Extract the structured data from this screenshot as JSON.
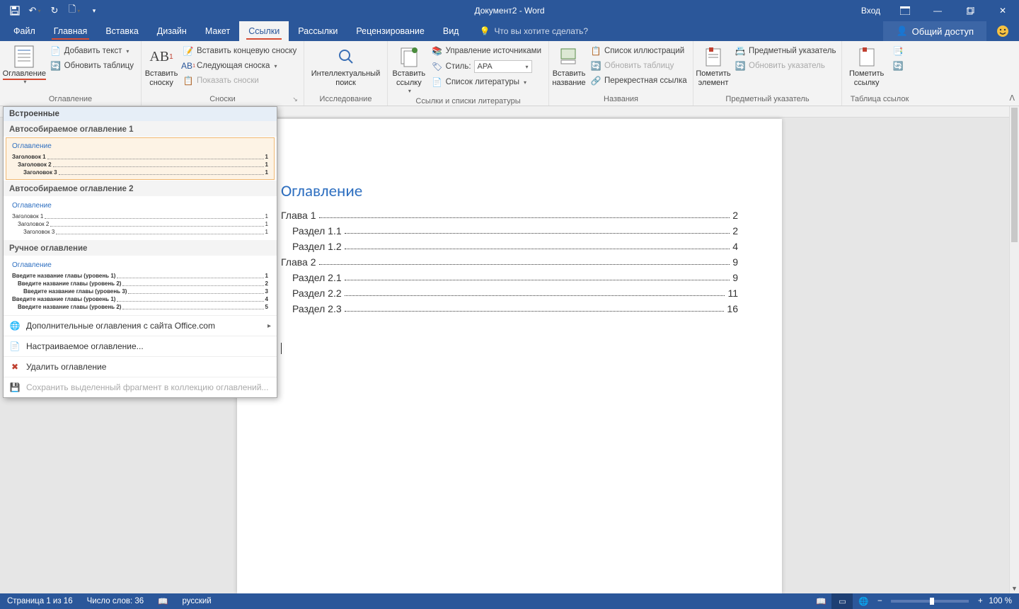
{
  "title": "Документ2  -  Word",
  "qat": {
    "save": "💾",
    "undo": "↶",
    "redo": "↻",
    "new": "🗋",
    "custom": "▾"
  },
  "titlebar_right": {
    "signin": "Вход",
    "ribbon_display": "▭",
    "minimize": "—",
    "maximize": "▢",
    "close": "✕"
  },
  "tabs": {
    "file": "Файл",
    "home": "Главная",
    "insert": "Вставка",
    "design": "Дизайн",
    "layout": "Макет",
    "references": "Ссылки",
    "mailings": "Рассылки",
    "review": "Рецензирование",
    "view": "Вид",
    "tellme_placeholder": "Что вы хотите сделать?",
    "share": "Общий доступ"
  },
  "ribbon": {
    "toc_btn": "Оглавление",
    "add_text": "Добавить текст",
    "update_table": "Обновить таблицу",
    "group_toc": "Оглавление",
    "insert_footnote": "Вставить\nсноску",
    "insert_endnote": "Вставить концевую сноску",
    "next_footnote": "Следующая сноска",
    "show_notes": "Показать сноски",
    "group_footnotes": "Сноски",
    "smart_lookup": "Интеллектуальный\nпоиск",
    "group_research": "Исследование",
    "insert_citation": "Вставить\nссылку",
    "manage_sources": "Управление источниками",
    "style_label": "Стиль:",
    "style_value": "APA",
    "bibliography": "Список литературы",
    "group_citations": "Ссылки и списки литературы",
    "insert_caption": "Вставить\nназвание",
    "figure_list": "Список иллюстраций",
    "update_table2": "Обновить таблицу",
    "cross_ref": "Перекрестная ссылка",
    "group_captions": "Названия",
    "mark_entry": "Пометить\nэлемент",
    "insert_index": "Предметный указатель",
    "update_index": "Обновить указатель",
    "group_index": "Предметный указатель",
    "mark_citation": "Пометить\nссылку",
    "insert_toa": "📑",
    "update_toa": "🔄",
    "group_toa": "Таблица ссылок"
  },
  "gallery": {
    "builtin_label": "Встроенные",
    "auto1_title": "Автособираемое оглавление 1",
    "auto2_title": "Автособираемое оглавление 2",
    "manual_title": "Ручное оглавление",
    "preview_title": "Оглавление",
    "auto1_lines": [
      {
        "t": "Заголовок 1",
        "p": "1",
        "indent": 0
      },
      {
        "t": "Заголовок 2",
        "p": "1",
        "indent": 1
      },
      {
        "t": "Заголовок 3",
        "p": "1",
        "indent": 2
      }
    ],
    "auto2_lines": [
      {
        "t": "Заголовок 1",
        "p": "1",
        "indent": 0
      },
      {
        "t": "Заголовок 2",
        "p": "1",
        "indent": 1
      },
      {
        "t": "Заголовок 3",
        "p": "1",
        "indent": 2
      }
    ],
    "manual_lines": [
      {
        "t": "Введите название главы (уровень 1)",
        "p": "1",
        "indent": 0
      },
      {
        "t": "Введите название главы (уровень 2)",
        "p": "2",
        "indent": 1
      },
      {
        "t": "Введите название главы (уровень 3)",
        "p": "3",
        "indent": 2
      },
      {
        "t": "Введите название главы (уровень 1)",
        "p": "4",
        "indent": 0
      },
      {
        "t": "Введите название главы (уровень 2)",
        "p": "5",
        "indent": 1
      }
    ],
    "cmd_more": "Дополнительные оглавления с сайта Office.com",
    "cmd_custom": "Настраиваемое оглавление...",
    "cmd_remove": "Удалить оглавление",
    "cmd_save": "Сохранить выделенный фрагмент в коллекцию оглавлений..."
  },
  "document": {
    "toc_title": "Оглавление",
    "rows": [
      {
        "level": 1,
        "text": "Глава 1",
        "page": "2"
      },
      {
        "level": 2,
        "text": "Раздел 1.1",
        "page": "2"
      },
      {
        "level": 2,
        "text": "Раздел 1.2",
        "page": "4"
      },
      {
        "level": 1,
        "text": "Глава 2",
        "page": "9"
      },
      {
        "level": 2,
        "text": "Раздел 2.1",
        "page": "9"
      },
      {
        "level": 2,
        "text": "Раздел 2.2",
        "page": "11"
      },
      {
        "level": 2,
        "text": "Раздел 2.3",
        "page": "16"
      }
    ]
  },
  "status": {
    "page": "Страница 1 из 16",
    "words": "Число слов: 36",
    "lang": "русский",
    "zoom": "100 %"
  }
}
